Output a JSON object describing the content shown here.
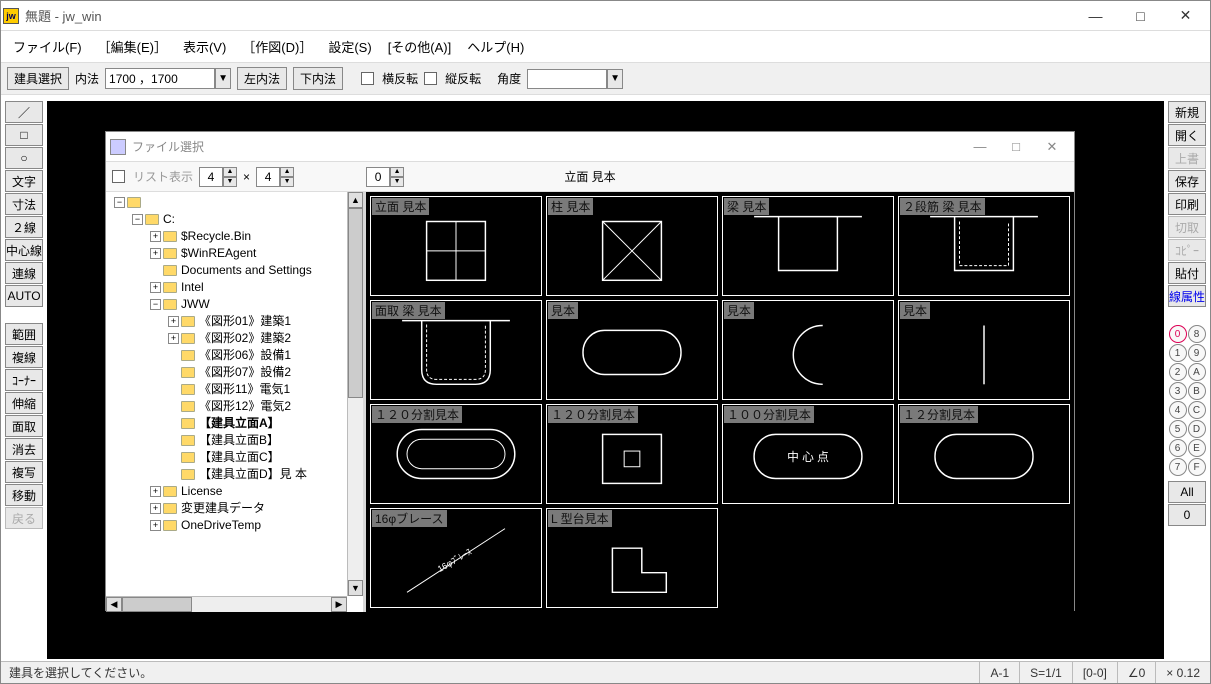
{
  "window": {
    "title": "無題 - jw_win",
    "app_icon_text": "jw"
  },
  "menubar": [
    "ファイル(F)",
    "［編集(E)］",
    "表示(V)",
    "［作図(D)］",
    "設定(S)",
    "[その他(A)]",
    "ヘルプ(H)"
  ],
  "optionbar": {
    "senkaku_btn": "建具選択",
    "naihou_label": "内法",
    "naihou_value": "1700 ，1700",
    "left_naihou_btn": "左内法",
    "down_naihou_btn": "下内法",
    "flip_h_label": "横反転",
    "flip_v_label": "縦反転",
    "angle_label": "角度",
    "angle_value": ""
  },
  "left_tools": [
    "／",
    "□",
    "○",
    "文字",
    "寸法",
    "２線",
    "中心線",
    "連線",
    "AUTO",
    "範囲",
    "複線",
    "ｺｰﾅｰ",
    "伸縮",
    "面取",
    "消去",
    "複写",
    "移動",
    "戻る"
  ],
  "right_tools": {
    "buttons": [
      "新規",
      "開く",
      "上書",
      "保存",
      "印刷",
      "切取",
      "ｺﾋﾟｰ",
      "貼付",
      "線属性"
    ],
    "disabled": [
      "上書",
      "切取",
      "ｺﾋﾟｰ"
    ],
    "blue": [
      "線属性"
    ],
    "all_btn": "All",
    "zero_btn": "0",
    "layers_left": [
      "0",
      "1",
      "2",
      "3",
      "4",
      "5",
      "6",
      "7"
    ],
    "layers_right": [
      "8",
      "9",
      "A",
      "B",
      "C",
      "D",
      "E",
      "F"
    ]
  },
  "statusbar": {
    "message": "建具を選択してください。",
    "cells": [
      "A-1",
      "S=1/1",
      "[0-0]",
      "∠0",
      "× 0.12"
    ]
  },
  "dialog": {
    "title": "ファイル選択",
    "list_label": "リスト表示",
    "cols": "4",
    "rows": "4",
    "mult": "×",
    "page": "0",
    "header": "立面 見本",
    "tree": [
      {
        "indent": 0,
        "exp": "−",
        "name": ""
      },
      {
        "indent": 1,
        "exp": "−",
        "name": "C:"
      },
      {
        "indent": 2,
        "exp": "+",
        "name": "$Recycle.Bin"
      },
      {
        "indent": 2,
        "exp": "+",
        "name": "$WinREAgent"
      },
      {
        "indent": 2,
        "exp": "",
        "name": "Documents and Settings"
      },
      {
        "indent": 2,
        "exp": "+",
        "name": "Intel"
      },
      {
        "indent": 2,
        "exp": "−",
        "name": "JWW"
      },
      {
        "indent": 3,
        "exp": "+",
        "name": "《図形01》建築1"
      },
      {
        "indent": 3,
        "exp": "+",
        "name": "《図形02》建築2"
      },
      {
        "indent": 3,
        "exp": "",
        "name": "《図形06》設備1"
      },
      {
        "indent": 3,
        "exp": "",
        "name": "《図形07》設備2"
      },
      {
        "indent": 3,
        "exp": "",
        "name": "《図形11》電気1"
      },
      {
        "indent": 3,
        "exp": "",
        "name": "《図形12》電気2"
      },
      {
        "indent": 3,
        "exp": "",
        "name": "【建具立面A】",
        "bold": true
      },
      {
        "indent": 3,
        "exp": "",
        "name": "【建具立面B】"
      },
      {
        "indent": 3,
        "exp": "",
        "name": "【建具立面C】"
      },
      {
        "indent": 3,
        "exp": "",
        "name": "【建具立面D】見 本"
      },
      {
        "indent": 2,
        "exp": "+",
        "name": "License"
      },
      {
        "indent": 2,
        "exp": "+",
        "name": "変更建具データ"
      },
      {
        "indent": 2,
        "exp": "+",
        "name": "OneDriveTemp"
      }
    ],
    "thumbs": [
      {
        "label": "立面 見本",
        "shape": "window4"
      },
      {
        "label": "柱 見本",
        "shape": "xbox"
      },
      {
        "label": "梁 見本",
        "shape": "beam-u"
      },
      {
        "label": "２段筋 梁 見本",
        "shape": "beam-u2"
      },
      {
        "label": "面取 梁 見本",
        "shape": "chamfer-u"
      },
      {
        "label": "見本",
        "shape": "stadium"
      },
      {
        "label": "見本",
        "shape": "arc-right"
      },
      {
        "label": "見本",
        "shape": "vline"
      },
      {
        "label": "１２０分割見本",
        "shape": "stadium-in"
      },
      {
        "label": "１２０分割見本",
        "shape": "smallbox"
      },
      {
        "label": "１００分割見本",
        "shape": "stadium-text",
        "text": "中 心 点"
      },
      {
        "label": "１２分割見本",
        "shape": "stadium"
      },
      {
        "label": "16φブレース",
        "shape": "brace",
        "text": "16φﾌﾞﾚｰｽ"
      },
      {
        "label": "L 型台見本",
        "shape": "lshape"
      }
    ]
  }
}
